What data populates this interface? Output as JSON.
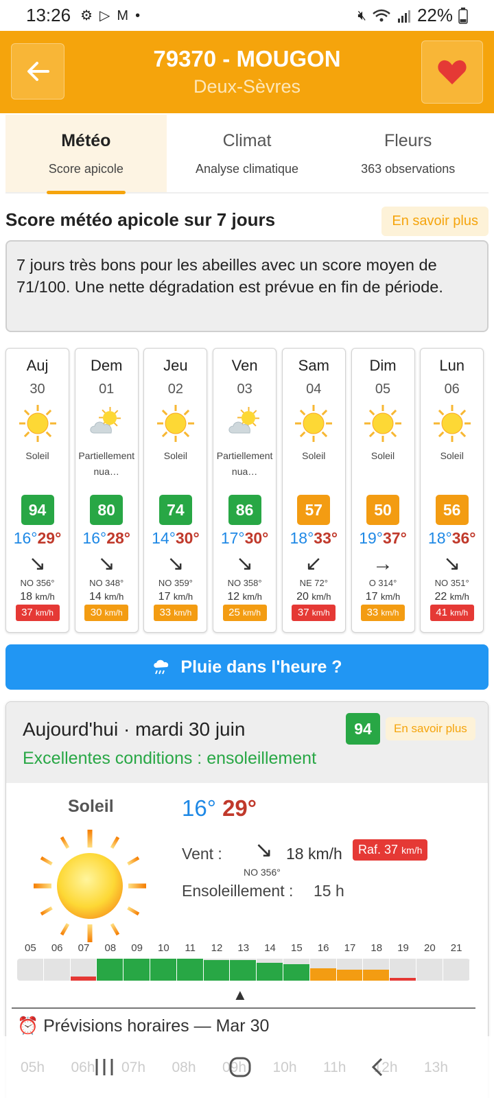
{
  "status_bar": {
    "time": "13:26",
    "battery": "22%",
    "icons": [
      "gear-icon",
      "play-icon",
      "mail-icon",
      "dot-icon",
      "mute-icon",
      "wifi-icon",
      "signal-icon",
      "battery-icon"
    ]
  },
  "header": {
    "title": "79370 - MOUGON",
    "subtitle": "Deux-Sèvres",
    "colors": {
      "bar": "#f5a40c",
      "heart": "#e53935"
    }
  },
  "tabs": [
    {
      "label": "Météo",
      "sub": "Score apicole",
      "active": true
    },
    {
      "label": "Climat",
      "sub": "Analyse climatique",
      "active": false
    },
    {
      "label": "Fleurs",
      "sub": "363 observations",
      "active": false
    }
  ],
  "section": {
    "title": "Score météo apicole sur 7 jours",
    "more_label": "En savoir plus",
    "summary": "7 jours très bons pour les abeilles avec un score moyen de 71/100. Une nette dégradation est prévue en fin de période."
  },
  "days": [
    {
      "name": "Auj",
      "date": "30",
      "icon": "sun-icon",
      "cond": "Soleil",
      "score": "94",
      "score_color": "#28a745",
      "tmin": "16°",
      "tmax": "29°",
      "arrow": "↘",
      "dir": "NO 356°",
      "speed": "18",
      "unit": "km/h",
      "gust": "37",
      "gust_color": "#e53935"
    },
    {
      "name": "Dem",
      "date": "01",
      "icon": "partly-cloudy-icon",
      "cond": "Partiellement nua…",
      "score": "80",
      "score_color": "#28a745",
      "tmin": "16°",
      "tmax": "28°",
      "arrow": "↘",
      "dir": "NO 348°",
      "speed": "14",
      "unit": "km/h",
      "gust": "30",
      "gust_color": "#f39c12"
    },
    {
      "name": "Jeu",
      "date": "02",
      "icon": "sun-icon",
      "cond": "Soleil",
      "score": "74",
      "score_color": "#28a745",
      "tmin": "14°",
      "tmax": "30°",
      "arrow": "↘",
      "dir": "NO 359°",
      "speed": "17",
      "unit": "km/h",
      "gust": "33",
      "gust_color": "#f39c12"
    },
    {
      "name": "Ven",
      "date": "03",
      "icon": "partly-cloudy-icon",
      "cond": "Partiellement nua…",
      "score": "86",
      "score_color": "#28a745",
      "tmin": "17°",
      "tmax": "30°",
      "arrow": "↘",
      "dir": "NO 358°",
      "speed": "12",
      "unit": "km/h",
      "gust": "25",
      "gust_color": "#f39c12"
    },
    {
      "name": "Sam",
      "date": "04",
      "icon": "sun-icon",
      "cond": "Soleil",
      "score": "57",
      "score_color": "#f39c12",
      "tmin": "18°",
      "tmax": "33°",
      "arrow": "↙",
      "dir": "NE 72°",
      "speed": "20",
      "unit": "km/h",
      "gust": "37",
      "gust_color": "#e53935"
    },
    {
      "name": "Dim",
      "date": "05",
      "icon": "sun-icon",
      "cond": "Soleil",
      "score": "50",
      "score_color": "#f39c12",
      "tmin": "19°",
      "tmax": "37°",
      "arrow": "→",
      "dir": "O 314°",
      "speed": "17",
      "unit": "km/h",
      "gust": "33",
      "gust_color": "#f39c12"
    },
    {
      "name": "Lun",
      "date": "06",
      "icon": "sun-icon",
      "cond": "Soleil",
      "score": "56",
      "score_color": "#f39c12",
      "tmin": "18°",
      "tmax": "36°",
      "arrow": "↘",
      "dir": "NO 351°",
      "speed": "22",
      "unit": "km/h",
      "gust": "41",
      "gust_color": "#e53935"
    }
  ],
  "rain_button": {
    "label": "Pluie dans l'heure ?",
    "icon": "rain-cloud-icon",
    "color": "#2196f3"
  },
  "today": {
    "title": "Aujourd'hui · mardi 30 juin",
    "score": "94",
    "more_label": "En savoir plus",
    "conditions": "Excellentes conditions : ensoleillement",
    "cond": "Soleil",
    "tmin": "16°",
    "tmax": "29°",
    "wind_label": "Vent :",
    "wind_arrow": "↘",
    "wind_dir": "NO 356°",
    "wind_speed": "18 km/h",
    "gust_label": "Raf. 37",
    "gust_unit": "km/h",
    "sun_label": "Ensoleillement :",
    "sun_value": "15 h",
    "hours": [
      {
        "h": "05",
        "level": 0,
        "color": ""
      },
      {
        "h": "06",
        "level": 0,
        "color": ""
      },
      {
        "h": "07",
        "level": 0.2,
        "color": "#e53935"
      },
      {
        "h": "08",
        "level": 1,
        "color": "#28a745"
      },
      {
        "h": "09",
        "level": 1,
        "color": "#28a745"
      },
      {
        "h": "10",
        "level": 1,
        "color": "#28a745"
      },
      {
        "h": "11",
        "level": 1,
        "color": "#28a745"
      },
      {
        "h": "12",
        "level": 0.95,
        "color": "#28a745"
      },
      {
        "h": "13",
        "level": 0.95,
        "color": "#28a745"
      },
      {
        "h": "14",
        "level": 0.8,
        "color": "#28a745"
      },
      {
        "h": "15",
        "level": 0.75,
        "color": "#28a745"
      },
      {
        "h": "16",
        "level": 0.55,
        "color": "#f39c12"
      },
      {
        "h": "17",
        "level": 0.5,
        "color": "#f39c12"
      },
      {
        "h": "18",
        "level": 0.5,
        "color": "#f39c12"
      },
      {
        "h": "19",
        "level": 0.12,
        "color": "#e53935"
      },
      {
        "h": "20",
        "level": 0,
        "color": ""
      },
      {
        "h": "21",
        "level": 0,
        "color": ""
      }
    ],
    "forecast_title": "Prévisions horaires — Mar 30"
  },
  "bottom_hours": [
    "05h",
    "06h",
    "07h",
    "08h",
    "09h",
    "10h",
    "11h",
    "12h",
    "13h"
  ]
}
